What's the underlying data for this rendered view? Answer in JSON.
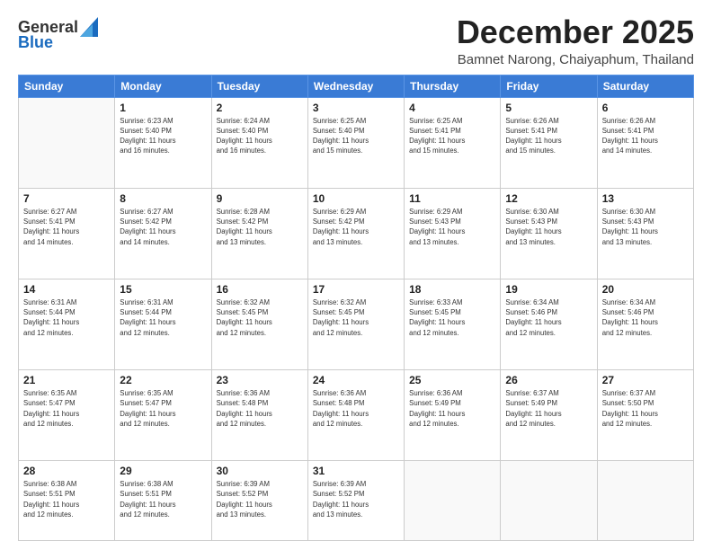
{
  "header": {
    "logo_line1": "General",
    "logo_line2": "Blue",
    "month": "December 2025",
    "location": "Bamnet Narong, Chaiyaphum, Thailand"
  },
  "calendar": {
    "days_of_week": [
      "Sunday",
      "Monday",
      "Tuesday",
      "Wednesday",
      "Thursday",
      "Friday",
      "Saturday"
    ],
    "weeks": [
      [
        {
          "day": "",
          "info": ""
        },
        {
          "day": "1",
          "info": "Sunrise: 6:23 AM\nSunset: 5:40 PM\nDaylight: 11 hours\nand 16 minutes."
        },
        {
          "day": "2",
          "info": "Sunrise: 6:24 AM\nSunset: 5:40 PM\nDaylight: 11 hours\nand 16 minutes."
        },
        {
          "day": "3",
          "info": "Sunrise: 6:25 AM\nSunset: 5:40 PM\nDaylight: 11 hours\nand 15 minutes."
        },
        {
          "day": "4",
          "info": "Sunrise: 6:25 AM\nSunset: 5:41 PM\nDaylight: 11 hours\nand 15 minutes."
        },
        {
          "day": "5",
          "info": "Sunrise: 6:26 AM\nSunset: 5:41 PM\nDaylight: 11 hours\nand 15 minutes."
        },
        {
          "day": "6",
          "info": "Sunrise: 6:26 AM\nSunset: 5:41 PM\nDaylight: 11 hours\nand 14 minutes."
        }
      ],
      [
        {
          "day": "7",
          "info": "Sunrise: 6:27 AM\nSunset: 5:41 PM\nDaylight: 11 hours\nand 14 minutes."
        },
        {
          "day": "8",
          "info": "Sunrise: 6:27 AM\nSunset: 5:42 PM\nDaylight: 11 hours\nand 14 minutes."
        },
        {
          "day": "9",
          "info": "Sunrise: 6:28 AM\nSunset: 5:42 PM\nDaylight: 11 hours\nand 13 minutes."
        },
        {
          "day": "10",
          "info": "Sunrise: 6:29 AM\nSunset: 5:42 PM\nDaylight: 11 hours\nand 13 minutes."
        },
        {
          "day": "11",
          "info": "Sunrise: 6:29 AM\nSunset: 5:43 PM\nDaylight: 11 hours\nand 13 minutes."
        },
        {
          "day": "12",
          "info": "Sunrise: 6:30 AM\nSunset: 5:43 PM\nDaylight: 11 hours\nand 13 minutes."
        },
        {
          "day": "13",
          "info": "Sunrise: 6:30 AM\nSunset: 5:43 PM\nDaylight: 11 hours\nand 13 minutes."
        }
      ],
      [
        {
          "day": "14",
          "info": "Sunrise: 6:31 AM\nSunset: 5:44 PM\nDaylight: 11 hours\nand 12 minutes."
        },
        {
          "day": "15",
          "info": "Sunrise: 6:31 AM\nSunset: 5:44 PM\nDaylight: 11 hours\nand 12 minutes."
        },
        {
          "day": "16",
          "info": "Sunrise: 6:32 AM\nSunset: 5:45 PM\nDaylight: 11 hours\nand 12 minutes."
        },
        {
          "day": "17",
          "info": "Sunrise: 6:32 AM\nSunset: 5:45 PM\nDaylight: 11 hours\nand 12 minutes."
        },
        {
          "day": "18",
          "info": "Sunrise: 6:33 AM\nSunset: 5:45 PM\nDaylight: 11 hours\nand 12 minutes."
        },
        {
          "day": "19",
          "info": "Sunrise: 6:34 AM\nSunset: 5:46 PM\nDaylight: 11 hours\nand 12 minutes."
        },
        {
          "day": "20",
          "info": "Sunrise: 6:34 AM\nSunset: 5:46 PM\nDaylight: 11 hours\nand 12 minutes."
        }
      ],
      [
        {
          "day": "21",
          "info": "Sunrise: 6:35 AM\nSunset: 5:47 PM\nDaylight: 11 hours\nand 12 minutes."
        },
        {
          "day": "22",
          "info": "Sunrise: 6:35 AM\nSunset: 5:47 PM\nDaylight: 11 hours\nand 12 minutes."
        },
        {
          "day": "23",
          "info": "Sunrise: 6:36 AM\nSunset: 5:48 PM\nDaylight: 11 hours\nand 12 minutes."
        },
        {
          "day": "24",
          "info": "Sunrise: 6:36 AM\nSunset: 5:48 PM\nDaylight: 11 hours\nand 12 minutes."
        },
        {
          "day": "25",
          "info": "Sunrise: 6:36 AM\nSunset: 5:49 PM\nDaylight: 11 hours\nand 12 minutes."
        },
        {
          "day": "26",
          "info": "Sunrise: 6:37 AM\nSunset: 5:49 PM\nDaylight: 11 hours\nand 12 minutes."
        },
        {
          "day": "27",
          "info": "Sunrise: 6:37 AM\nSunset: 5:50 PM\nDaylight: 11 hours\nand 12 minutes."
        }
      ],
      [
        {
          "day": "28",
          "info": "Sunrise: 6:38 AM\nSunset: 5:51 PM\nDaylight: 11 hours\nand 12 minutes."
        },
        {
          "day": "29",
          "info": "Sunrise: 6:38 AM\nSunset: 5:51 PM\nDaylight: 11 hours\nand 12 minutes."
        },
        {
          "day": "30",
          "info": "Sunrise: 6:39 AM\nSunset: 5:52 PM\nDaylight: 11 hours\nand 13 minutes."
        },
        {
          "day": "31",
          "info": "Sunrise: 6:39 AM\nSunset: 5:52 PM\nDaylight: 11 hours\nand 13 minutes."
        },
        {
          "day": "",
          "info": ""
        },
        {
          "day": "",
          "info": ""
        },
        {
          "day": "",
          "info": ""
        }
      ]
    ]
  }
}
